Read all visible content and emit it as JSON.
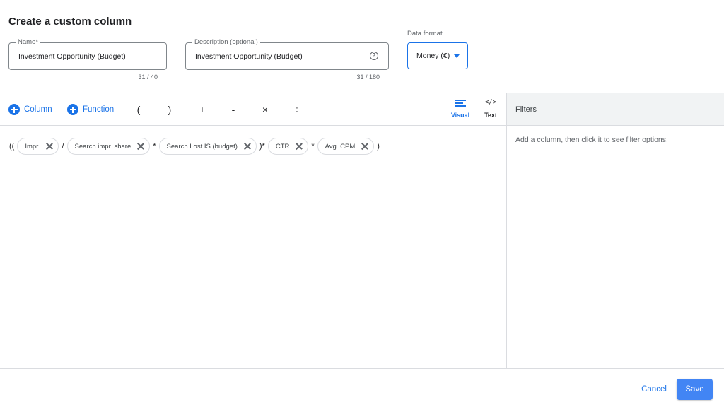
{
  "dialog": {
    "title": "Create a custom column"
  },
  "name_field": {
    "label": "Name*",
    "value": "Investment Opportunity (Budget)",
    "count": "31 / 40"
  },
  "description_field": {
    "label": "Description (optional)",
    "value": "Investment Opportunity (Budget)",
    "count": "31 / 180",
    "help_icon": "help-circle-icon"
  },
  "data_format": {
    "label": "Data format",
    "selected": "Money (€)"
  },
  "toolbar": {
    "column_label": "Column",
    "function_label": "Function",
    "operators": [
      "(",
      ")",
      "+",
      "-",
      "×",
      "÷"
    ],
    "visual_label": "Visual",
    "text_label": "Text"
  },
  "formula": {
    "open": "((",
    "chips": [
      "Impr.",
      "Search impr. share",
      "Search Lost IS (budget)",
      "CTR",
      "Avg. CPM"
    ],
    "operators": [
      "/",
      "*",
      ")*",
      "*",
      ")"
    ]
  },
  "filters": {
    "title": "Filters",
    "hint": "Add a column, then click it to see filter options."
  },
  "footer": {
    "cancel_label": "Cancel",
    "save_label": "Save"
  },
  "colors": {
    "accent": "#1a73e8",
    "save_button": "#4285f4",
    "border": "#dadce0",
    "panel_bg": "#f1f3f4"
  }
}
